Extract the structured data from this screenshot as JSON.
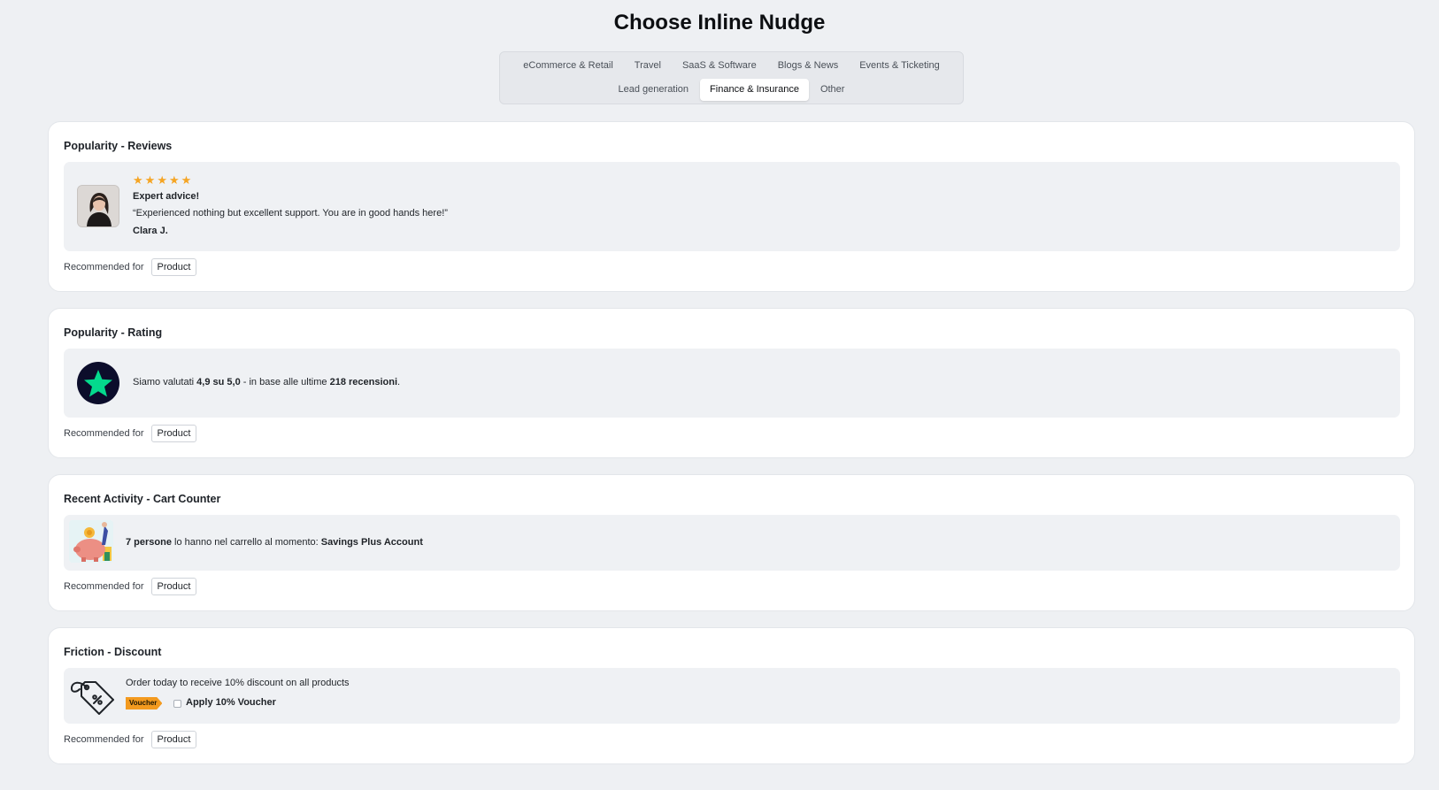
{
  "page": {
    "title": "Choose Inline Nudge"
  },
  "tabs": {
    "row1": [
      "eCommerce & Retail",
      "Travel",
      "SaaS & Software",
      "Blogs & News",
      "Events & Ticketing"
    ],
    "row2": [
      "Lead generation",
      "Finance & Insurance",
      "Other"
    ],
    "active": "Finance & Insurance"
  },
  "recommended_label": "Recommended for",
  "cards": {
    "reviews": {
      "title": "Popularity - Reviews",
      "rating_stars": 5,
      "headline": "Expert advice!",
      "quote": "“Experienced nothing but excellent support. You are in good hands here!”",
      "author": "Clara J.",
      "tag": "Product"
    },
    "rating": {
      "title": "Popularity - Rating",
      "text_prefix": "Siamo valutati ",
      "score": "4,9 su 5,0",
      "text_mid": " - in base alle ultime ",
      "count": "218 recensioni",
      "text_suffix": ".",
      "tag": "Product"
    },
    "cart": {
      "title": "Recent Activity - Cart Counter",
      "count": "7 persone",
      "text_mid": " lo hanno nel carrello al momento: ",
      "product": "Savings Plus Account",
      "tag": "Product"
    },
    "discount": {
      "title": "Friction - Discount",
      "text": "Order today to receive 10% discount on all products",
      "voucher_badge": "Voucher",
      "checkbox_label": "Apply 10% Voucher",
      "tag": "Product"
    }
  },
  "colors": {
    "star": "#f5a524",
    "trustpilot_green": "#04da8d",
    "voucher": "#f39a1f"
  }
}
